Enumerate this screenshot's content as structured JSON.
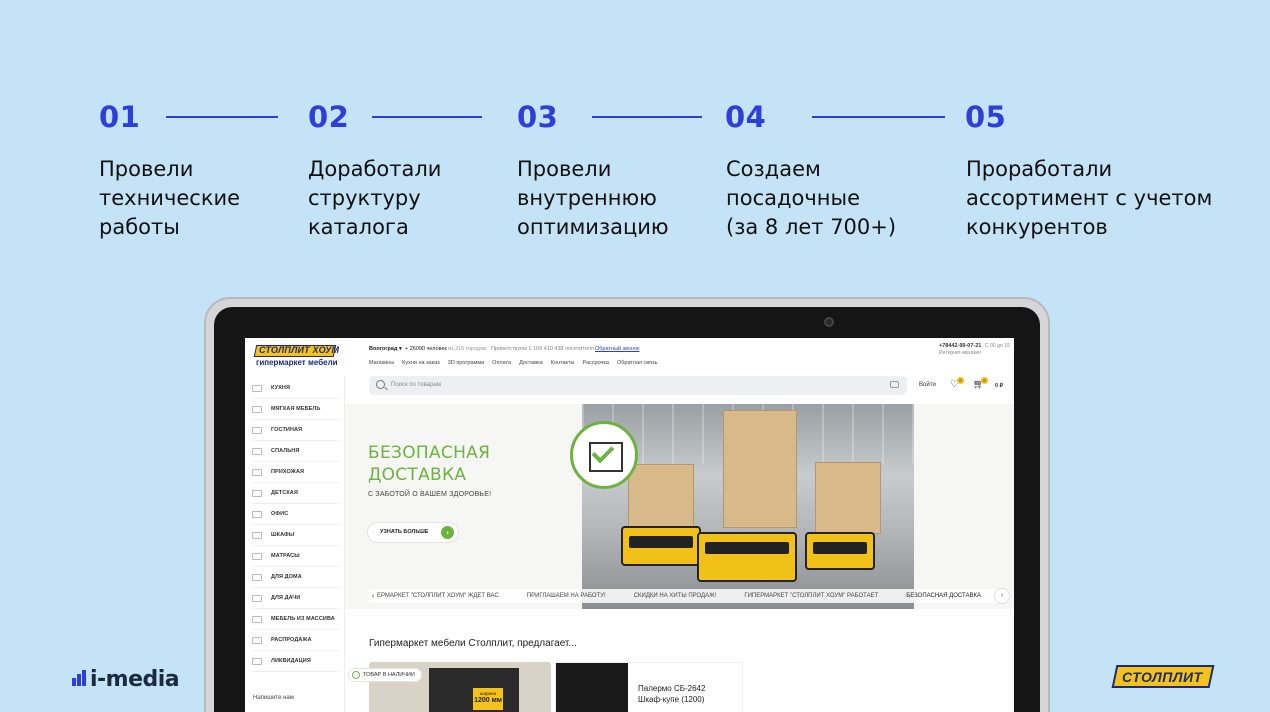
{
  "steps": [
    {
      "num": "01",
      "text": "Провели\nтехнические\nработы"
    },
    {
      "num": "02",
      "text": "Доработали\nструктуру\nкаталога"
    },
    {
      "num": "03",
      "text": "Провели\nвнутреннюю\nоптимизацию"
    },
    {
      "num": "04",
      "text": "Создаем\nпосадочные\n(за 8 лет 700+)"
    },
    {
      "num": "05",
      "text": "Проработали\nассортимент с учетом\nконкурентов"
    }
  ],
  "colors": {
    "accent": "#2d3fd8",
    "background": "#c5e3f7",
    "brand_yellow": "#f4c21a",
    "brand_green": "#6cb33f"
  },
  "site": {
    "logo_text": "СТОЛПЛИТ ХОУМ",
    "logo_sub": "гипермаркет мебели",
    "city": "Волгоград",
    "visitors_count": "+ 26090 человек",
    "visitors_suffix": "из 216 городов.",
    "visitors_line": "Приветствуем 1 109 410 438 посетителя",
    "callback": "Обратный звонок",
    "phone": "+78442-99-07-21",
    "hours": "С 00 до 19",
    "shop_label": "Интернет-магазин",
    "menu": [
      "Магазины",
      "Кухни на заказ",
      "3D программа",
      "Оплата",
      "Доставка",
      "Контакты",
      "Рассрочка",
      "Обратная связь"
    ],
    "search_placeholder": "Поиск по товарам",
    "login": "Войти",
    "favorites_count": "0",
    "cart_count": "0",
    "cart_total": "0 ₽",
    "sidebar": [
      "КУХНЯ",
      "МЯГКАЯ МЕБЕЛЬ",
      "ГОСТИНАЯ",
      "СПАЛЬНЯ",
      "ПРИХОЖАЯ",
      "ДЕТСКАЯ",
      "ОФИС",
      "ШКАФЫ",
      "МАТРАСЫ",
      "ДЛЯ ДОМА",
      "ДЛЯ ДАЧИ",
      "МЕБЕЛЬ ИЗ МАССИВА",
      "РАСПРОДАЖА",
      "ЛИКВИДАЦИЯ"
    ],
    "sidebar_write": "Напишите нам",
    "banner": {
      "title": "БЕЗОПАСНАЯ\nДОСТАВКА",
      "subtitle": "С ЗАБОТОЙ О ВАШЕМ ЗДОРОВЬЕ!",
      "button": "УЗНАТЬ БОЛЬШЕ"
    },
    "ticker": [
      "ЕРМАРКЕТ \"СТОЛПЛИТ ХОУМ\" ЖДЕТ ВАС",
      "ПРИГЛАШАЕМ НА РАБОТУ!",
      "СКИДКИ НА ХИТЫ ПРОДАЖ!",
      "ГИПЕРМАРКЕТ \"СТОЛПЛИТ ХОУМ\" РАБОТАЕТ",
      "БЕЗОПАСНАЯ ДОСТАВКА"
    ],
    "offers_title": "Гипермаркет мебели Столплит, предлагает...",
    "card_badge": "ТОВАР В НАЛИЧИИ",
    "price_tag_top": "ширина",
    "price_tag_value": "1200 мм",
    "card2_text": "Палермо СБ-2642\nШкаф-купе (1200)"
  },
  "footer": {
    "imedia": "i-media",
    "stolplit": "СТОЛПЛИТ"
  }
}
